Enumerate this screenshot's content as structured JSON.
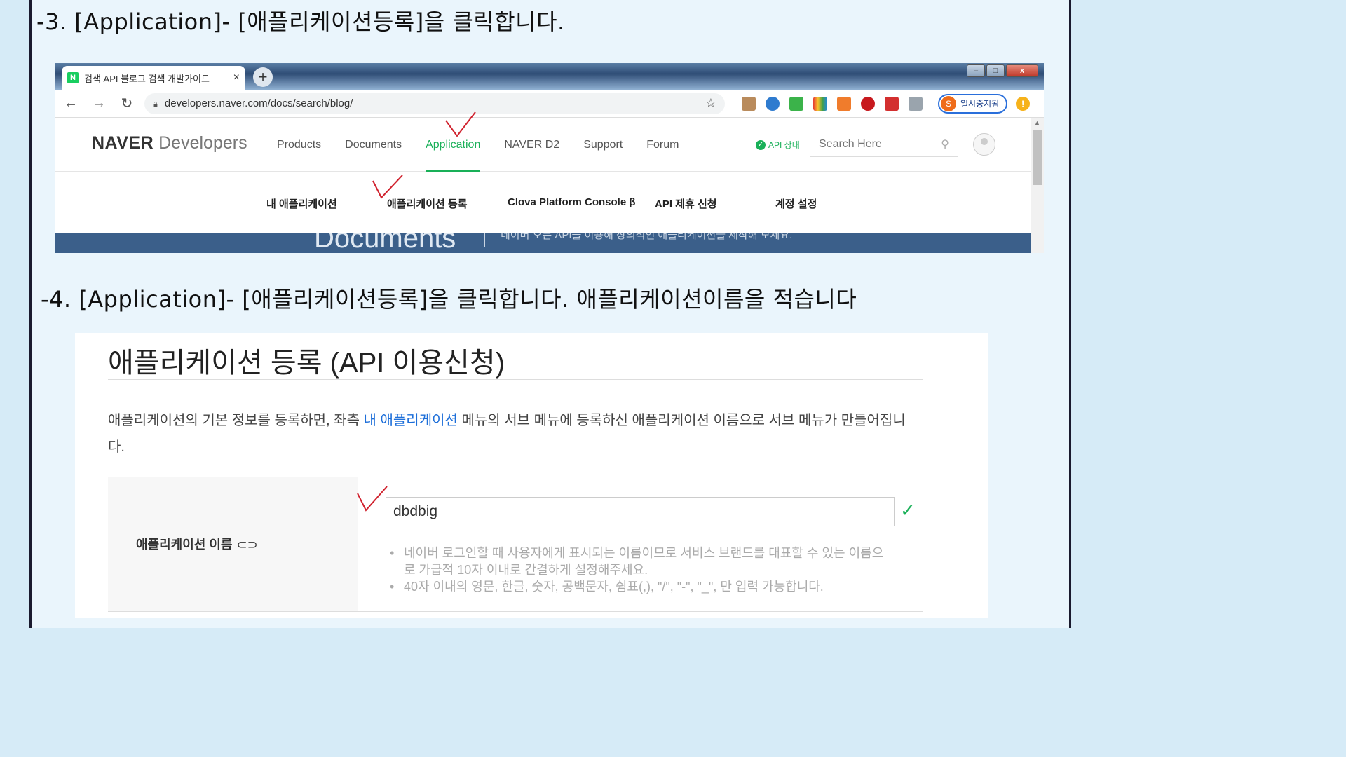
{
  "step3": {
    "title": "-3. [Application]- [애플리케이션등록]을 클릭합니다."
  },
  "step4": {
    "title": "-4. [Application]- [애플리케이션등록]을 클릭합니다.  애플리케이션이름을 적습니다"
  },
  "browser": {
    "tab_title": "검색 API 블로그 검색 개발가이드",
    "tab_close": "×",
    "new_tab": "+",
    "url": "developers.naver.com/docs/search/blog/",
    "profile_initial": "S",
    "profile_label": "일시중지됨",
    "win_min": "–",
    "win_max": "□",
    "win_close": "x"
  },
  "site": {
    "logo_bold": "NAVER",
    "logo_light": "Developers",
    "nav": [
      "Products",
      "Documents",
      "Application",
      "NAVER D2",
      "Support",
      "Forum"
    ],
    "api_status": "API 상태",
    "search_placeholder": "Search Here",
    "subnav": [
      "내 애플리케이션",
      "애플리케이션 등록",
      "Clova Platform Console β",
      "API 제휴 신청",
      "계정 설정"
    ],
    "banner_title": "Documents",
    "banner_text": "네이버 오픈 API를 이용해 창의적인 애플리케이션을 제작해 보세요."
  },
  "registration": {
    "title": "애플리케이션 등록 (API 이용신청)",
    "desc_before": "애플리케이션의 기본 정보를 등록하면, 좌측 ",
    "desc_link": "내 애플리케이션",
    "desc_after": " 메뉴의 서브 메뉴에 등록하신 애플리케이션 이름으로 서브 메뉴가 만들어집니다.",
    "field_label": "애플리케이션 이름",
    "field_value": "dbdbig",
    "hints": [
      "네이버 로그인할 때 사용자에게 표시되는 이름이므로 서비스 브랜드를 대표할 수 있는 이름으로 가급적 10자 이내로 간결하게 설정해주세요.",
      "40자 이내의 영문, 한글, 숫자, 공백문자, 쉼표(,), \"/\", \"-\", \"_\", 만 입력 가능합니다."
    ]
  },
  "colors": {
    "accent_green": "#19b058",
    "link_blue": "#1e6fd9",
    "tick_red": "#d0212d",
    "slide_bg": "#eaf5fc"
  }
}
